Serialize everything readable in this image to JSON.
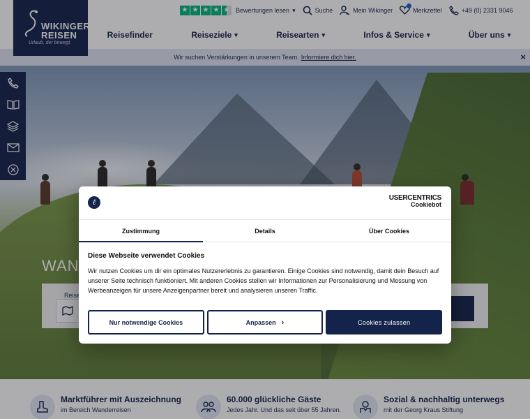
{
  "brand": {
    "name_line1": "WIKINGER",
    "name_line2": "REISEN",
    "claim": "Urlaub, der bewegt."
  },
  "topbar": {
    "reviews_label": "Bewertungen lesen",
    "search_label": "Suche",
    "account_label": "Mein Wikinger",
    "wishlist_label": "Merkzettel",
    "phone": "+49 (0) 2331 9046"
  },
  "nav": {
    "items": [
      {
        "label": "Reisefinder",
        "has_dropdown": false
      },
      {
        "label": "Reiseziele",
        "has_dropdown": true
      },
      {
        "label": "Reisearten",
        "has_dropdown": true
      },
      {
        "label": "Infos & Service",
        "has_dropdown": true
      },
      {
        "label": "Über uns",
        "has_dropdown": true
      }
    ]
  },
  "notice": {
    "text": "Wir suchen Verstärkungen in unserem Team.",
    "link": "Informiere dich hier.",
    "close": "×"
  },
  "hero": {
    "title": "WAN",
    "search_label": "Reise"
  },
  "features": [
    {
      "title": "Marktführer mit Auszeichnung",
      "subtitle": "im Bereich Wanderreisen",
      "icon": "boot-icon"
    },
    {
      "title": "60.000 glückliche Gäste",
      "subtitle": "Jedes Jahr. Und das seit über 55 Jahren.",
      "icon": "group-icon"
    },
    {
      "title": "Sozial & nachhaltig unterwegs",
      "subtitle": "mit der Georg Kraus Stiftung",
      "icon": "hands-icon"
    }
  ],
  "cookie": {
    "logo_glyph": "ℓ",
    "provider_line1": "USERCENTRICS",
    "provider_line2": "Cookiebot",
    "tabs": [
      "Zustimmung",
      "Details",
      "Über Cookies"
    ],
    "active_tab": "Zustimmung",
    "heading": "Diese Webseite verwendet Cookies",
    "text": "Wir nutzen Cookies um dir ein optimales Nutzererlebnis zu garantieren. Einige Cookies sind notwendig, damit dein Besuch auf unserer Seite technisch funktioniert. Mit anderen Cookies stellen wir Informationen zur Personalisierung und Messung von Werbeanzeigen für unsere Anzeigenpartner bereit und analysieren unseren Traffic.",
    "buttons": {
      "necessary": "Nur notwendige Cookies",
      "customize": "Anpassen",
      "accept": "Cookies zulassen"
    }
  },
  "colors": {
    "brand_navy": "#14234a",
    "trustpilot_green": "#00b67a",
    "notice_bg": "#dfe4ef"
  }
}
